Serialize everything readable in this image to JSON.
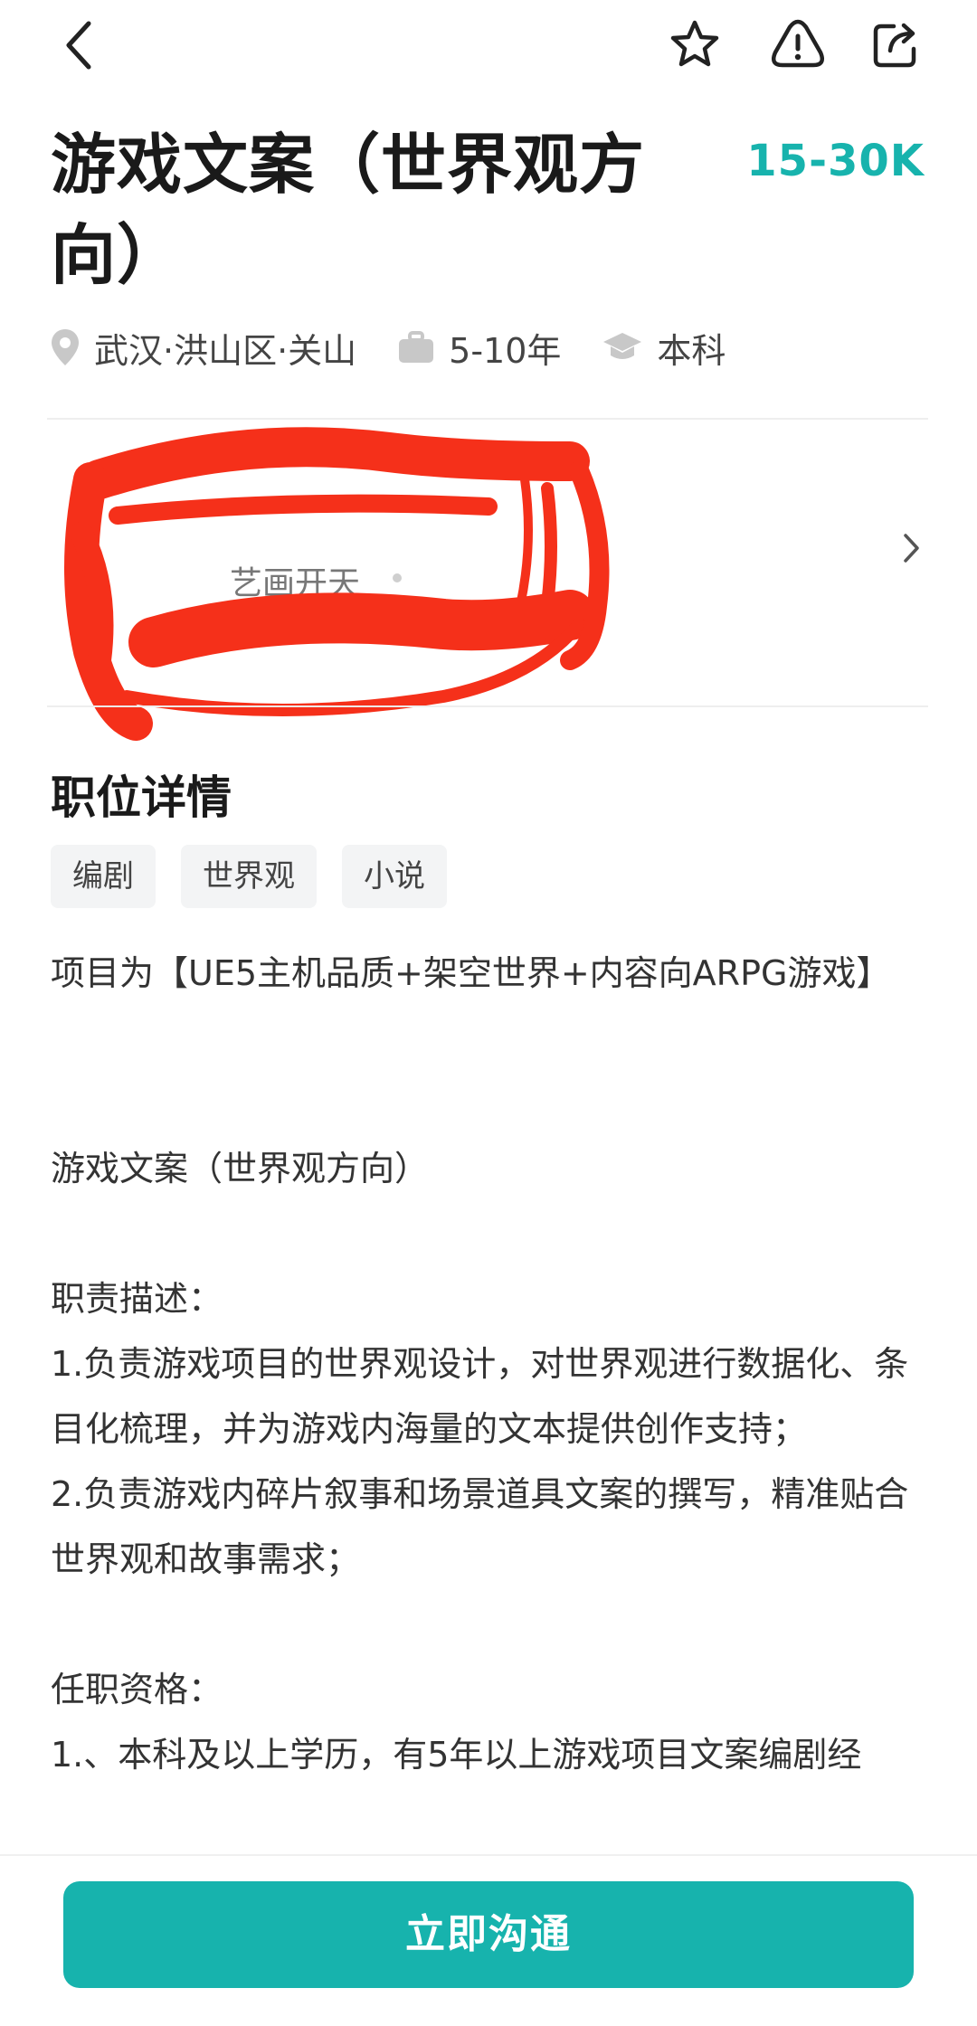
{
  "job": {
    "title": "游戏文案（世界观方向）",
    "salary": "15-30K",
    "location": "武汉·洪山区·关山",
    "experience": "5-10年",
    "education": "本科"
  },
  "company": {
    "name": "艺画开天"
  },
  "details": {
    "section_title": "职位详情",
    "tags": [
      "编剧",
      "世界观",
      "小说"
    ],
    "description": "项目为【UE5主机品质+架空世界+内容向ARPG游戏】\n\n\n游戏文案（世界观方向）\n\n职责描述：\n1.负责游戏项目的世界观设计，对世界观进行数据化、条目化梳理，并为游戏内海量的文本提供创作支持；\n2.负责游戏内碎片叙事和场景道具文案的撰写，精准贴合世界观和故事需求；\n\n任职资格：\n1.、本科及以上学历，有5年以上游戏项目文案编剧经"
  },
  "actions": {
    "cta_label": "立即沟通"
  },
  "colors": {
    "accent": "#17b3ad",
    "redaction": "#f5301a"
  }
}
